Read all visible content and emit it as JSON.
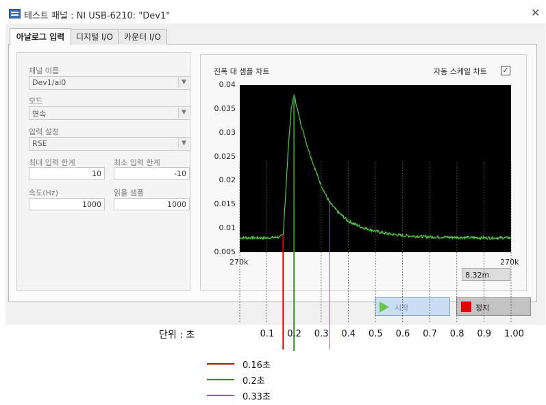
{
  "window": {
    "title": "테스트 패널 : NI USB-6210: \"Dev1\"",
    "close_glyph": "✕"
  },
  "tabs": [
    {
      "label": "아날로그 입력",
      "active": true
    },
    {
      "label": "디지털 I/O",
      "active": false
    },
    {
      "label": "카운터 I/O",
      "active": false
    }
  ],
  "settings": {
    "channel_label": "채널 이름",
    "channel_value": "Dev1/ai0",
    "mode_label": "모드",
    "mode_value": "연속",
    "input_config_label": "입력 설정",
    "input_config_value": "RSE",
    "max_limit_label": "최대 입력 한계",
    "max_limit_value": "10",
    "min_limit_label": "최소 입력 한계",
    "min_limit_value": "-10",
    "rate_label": "속도(Hz)",
    "rate_value": "1000",
    "samples_label": "읽을 샘플",
    "samples_value": "1000"
  },
  "chart_panel": {
    "title": "진폭 대 샘플 차트",
    "autoscale_label": "자동 스케일 차트",
    "autoscale_check": "✓",
    "x_min_label": "270k",
    "x_max_label": "270k",
    "x_readout": "8.32m"
  },
  "buttons": {
    "start": "시작",
    "stop": "정지"
  },
  "annotation": {
    "unit_label": "단위 : 초",
    "seconds_labels": [
      "0.1",
      "0.2",
      "0.3",
      "0.4",
      "0.5",
      "0.6",
      "0.7",
      "0.8",
      "0.9",
      "1.00"
    ],
    "markers": [
      {
        "label": "0.16초",
        "color": "#e00000",
        "x": 0.16
      },
      {
        "label": "0.2초",
        "color": "#3a8a2a",
        "x": 0.2
      },
      {
        "label": "0.33초",
        "color": "#8a5ea0",
        "x": 0.33
      }
    ]
  },
  "colors": {
    "plot_bg": "#000000",
    "trace": "#4cd23a"
  },
  "chart_data": {
    "type": "line",
    "title": "진폭 대 샘플 차트",
    "x_unit": "초",
    "xlim": [
      0,
      1.0
    ],
    "ylim": [
      0.005,
      0.04
    ],
    "yticks": [
      "0.04",
      "0.035",
      "0.03",
      "0.025",
      "0.02",
      "0.015",
      "0.01",
      "0.005"
    ],
    "series": [
      {
        "x": [
          0.0,
          0.05,
          0.1,
          0.15,
          0.16,
          0.17,
          0.18,
          0.19,
          0.2,
          0.22,
          0.25,
          0.28,
          0.3,
          0.33,
          0.36,
          0.4,
          0.45,
          0.5,
          0.55,
          0.6,
          0.7,
          0.8,
          0.9,
          1.0
        ],
        "y": [
          0.008,
          0.008,
          0.008,
          0.0082,
          0.0087,
          0.018,
          0.028,
          0.035,
          0.038,
          0.033,
          0.027,
          0.022,
          0.019,
          0.0155,
          0.0135,
          0.0115,
          0.0102,
          0.0094,
          0.0088,
          0.0085,
          0.0082,
          0.0081,
          0.008,
          0.008
        ]
      }
    ]
  }
}
